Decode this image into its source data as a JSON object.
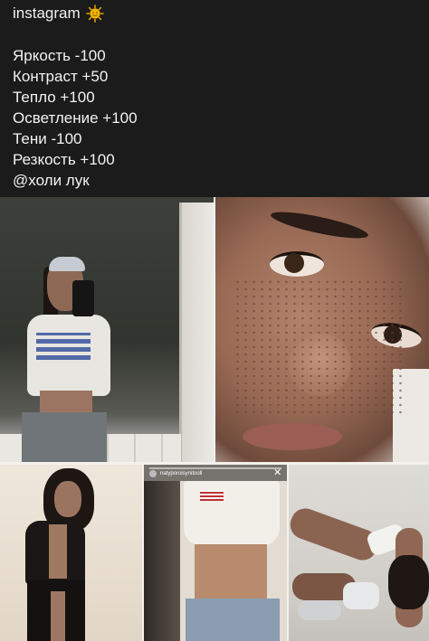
{
  "header": {
    "title": "instagram",
    "title_icon": "sun-emoji-icon",
    "settings": [
      "Яркость -100",
      "Контраст +50",
      "Тепло +100",
      "Осветление +100",
      "Тени -100",
      "Резкость +100",
      "@холи лук"
    ]
  },
  "photos": [
    {
      "name": "mirror-selfie-photo"
    },
    {
      "name": "freckled-face-closeup-photo"
    },
    {
      "name": "dark-outfit-photo"
    },
    {
      "name": "story-screenshot-photo",
      "username": "natyporoisynitooll",
      "close_glyph": "✕"
    },
    {
      "name": "floor-pose-photo"
    }
  ],
  "colors": {
    "background": "#1b1b1b",
    "text": "#f2f2f2",
    "sun_icon": "#f4b400"
  }
}
